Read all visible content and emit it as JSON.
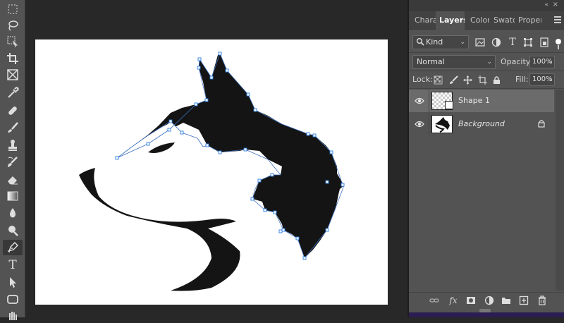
{
  "toolbar": {
    "tools": [
      {
        "name": "marquee-tool-icon"
      },
      {
        "name": "lasso-tool-icon"
      },
      {
        "name": "object-selection-tool-icon"
      },
      {
        "name": "crop-tool-icon"
      },
      {
        "name": "frame-tool-icon"
      },
      {
        "name": "eyedropper-tool-icon"
      },
      {
        "name": "healing-brush-tool-icon"
      },
      {
        "name": "brush-tool-icon"
      },
      {
        "name": "clone-stamp-tool-icon"
      },
      {
        "name": "history-brush-tool-icon"
      },
      {
        "name": "eraser-tool-icon"
      },
      {
        "name": "gradient-tool-icon"
      },
      {
        "name": "blur-tool-icon"
      },
      {
        "name": "dodge-tool-icon"
      },
      {
        "name": "pen-tool-icon",
        "active": true
      },
      {
        "name": "type-tool-icon",
        "glyph": "T"
      },
      {
        "name": "path-selection-tool-icon"
      },
      {
        "name": "rectangle-tool-icon"
      },
      {
        "name": "hand-tool-icon"
      }
    ]
  },
  "panel": {
    "collapse_glyph": "«",
    "close_glyph": "×",
    "tabs": [
      {
        "label": "Chara",
        "active": false
      },
      {
        "label": "Layers",
        "active": true
      },
      {
        "label": "Color",
        "active": false
      },
      {
        "label": "Swatc",
        "active": false
      },
      {
        "label": "Proper",
        "active": false
      }
    ],
    "filter": {
      "kind_label": "Kind",
      "icons": [
        "image-filter-icon",
        "adjustment-filter-icon",
        "type-filter-icon",
        "shape-filter-icon",
        "smart-object-filter-icon"
      ]
    },
    "blend_mode": "Normal",
    "opacity_label": "Opacity:",
    "opacity_value": "100%",
    "lock_label": "Lock:",
    "fill_label": "Fill:",
    "fill_value": "100%",
    "layers": [
      {
        "name": "Shape 1",
        "selected": true,
        "visible": true,
        "italic": false,
        "thumb": "shape"
      },
      {
        "name": "Background",
        "selected": false,
        "visible": true,
        "italic": true,
        "thumb": "background",
        "locked": true
      }
    ],
    "bottom_icons": [
      "link-layers-icon",
      "fx-icon",
      "layer-mask-icon",
      "adjustment-layer-icon",
      "group-folder-icon",
      "new-layer-icon",
      "trash-icon"
    ],
    "fx_label": "fx"
  },
  "colors": {
    "ui_panel": "#535353",
    "workspace": "#282828",
    "canvas": "#ffffff",
    "artwork": "#141414",
    "path_anchor": "#2a7de1"
  }
}
